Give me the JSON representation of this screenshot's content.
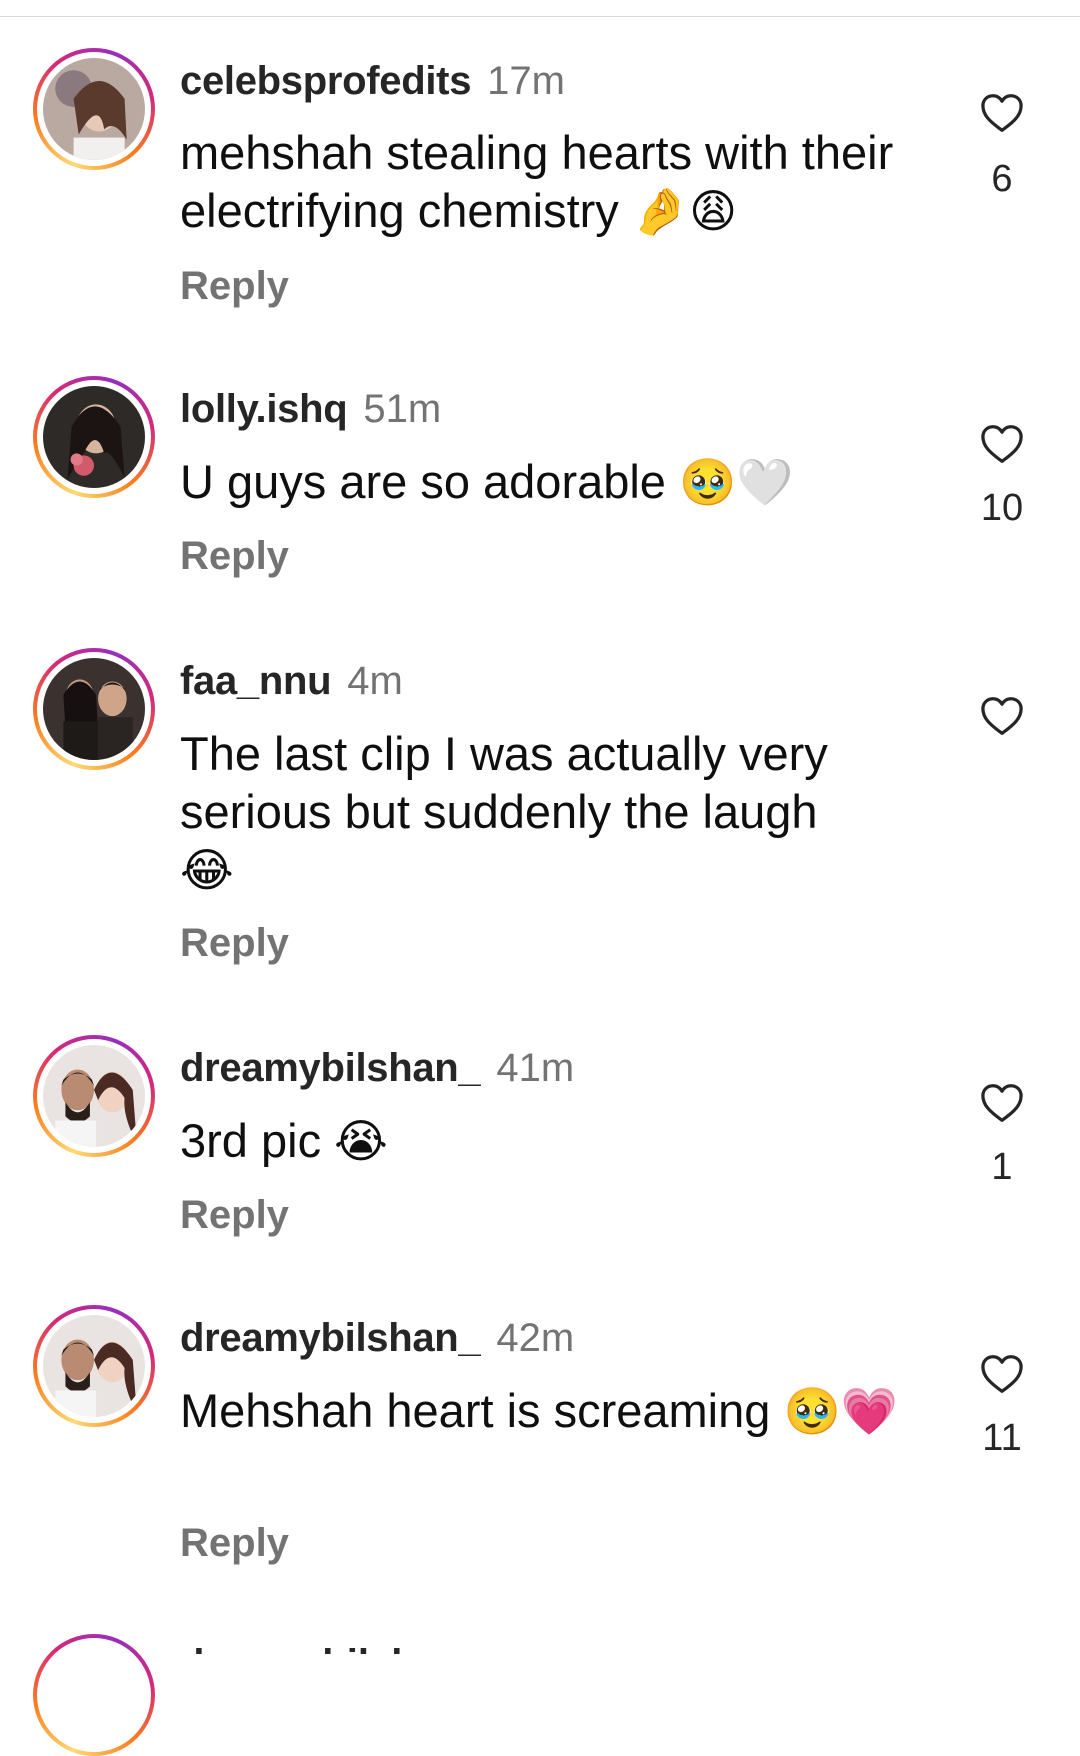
{
  "comments": [
    {
      "username": "celebsprofedits",
      "time": "17m",
      "text": "mehshah stealing hearts with their electrifying chemistry",
      "emojis": "🤌😩",
      "reply_label": "Reply",
      "likes": "6"
    },
    {
      "username": "lolly.ishq",
      "time": "51m",
      "text": "U guys are so adorable",
      "emojis": "🥹🤍",
      "reply_label": "Reply",
      "likes": "10"
    },
    {
      "username": "faa_nnu",
      "time": "4m",
      "text": "The last clip I was actually very serious but suddenly the laugh",
      "emojis": "😂",
      "reply_label": "Reply",
      "likes": ""
    },
    {
      "username": "dreamybilshan_",
      "time": "41m",
      "text": "3rd pic",
      "emojis": "😭",
      "reply_label": "Reply",
      "likes": "1"
    },
    {
      "username": "dreamybilshan_",
      "time": "42m",
      "text": "Mehshah heart is screaming",
      "emojis": "🥹💗",
      "reply_label": "Reply",
      "likes": "11"
    }
  ],
  "partial_comment": {
    "username": "dreamybilshan_"
  },
  "icons": {
    "like": "heart-outline-icon"
  },
  "colors": {
    "username": "#262626",
    "secondary": "#737373",
    "heart_outline": "#262626"
  }
}
